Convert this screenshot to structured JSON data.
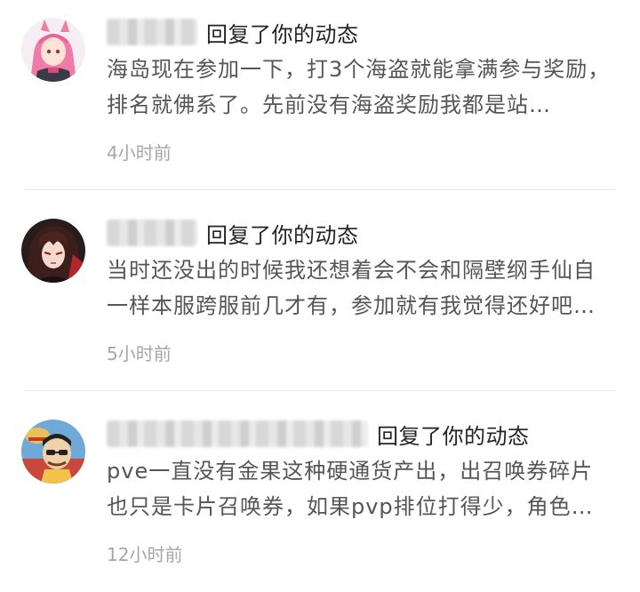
{
  "notifications": [
    {
      "action": "回复了你的动态",
      "content": "海岛现在参加一下，打3个海盗就能拿满参与奖励，排名就佛系了。先前没有海盗奖励我都是站…",
      "time": "4小时前",
      "avatar": "anime-girl-pink-hair-avatar"
    },
    {
      "action": "回复了你的动态",
      "content": "当时还没出的时候我还想着会不会和隔壁纲手仙自一样本服跨服前几才有，参加就有我觉得还好吧…",
      "time": "5小时前",
      "avatar": "anime-dark-hair-avatar"
    },
    {
      "action": "回复了你的动态",
      "content": "pve一直没有金果这种硬通货产出，出召唤券碎片也只是卡片召唤券，如果pvp排位打得少，角色…",
      "time": "12小时前",
      "avatar": "cartoon-pirate-avatar"
    }
  ],
  "colors": {
    "action_text": "#222222",
    "content_text": "#555555",
    "time_text": "#a6a6a6",
    "divider": "#e8e8e8"
  }
}
